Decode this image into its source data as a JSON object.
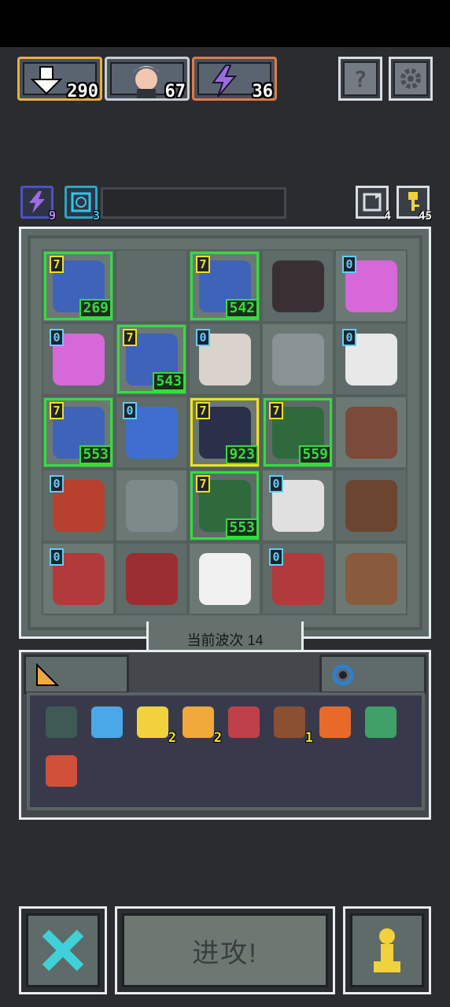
{
  "top_resources": {
    "energy": {
      "value": "290",
      "icon": "down-arrow-icon"
    },
    "hero": {
      "value": "67",
      "icon": "hero-portrait-icon"
    },
    "bolt": {
      "value": "36",
      "icon": "lightning-icon"
    }
  },
  "top_buttons": {
    "help_icon": "question-icon",
    "settings_icon": "gear-icon"
  },
  "buffs": {
    "lightning": {
      "count": "9",
      "icon": "lightning-icon"
    },
    "clock": {
      "count": "3",
      "icon": "clock-icon"
    }
  },
  "side_counters": {
    "refresh": {
      "count": "4",
      "icon": "refresh-icon"
    },
    "key": {
      "count": "45",
      "icon": "key-icon"
    }
  },
  "board": {
    "cells": [
      {
        "unit": "shadow-knight",
        "level": "7",
        "damage": "269",
        "highlight": "green",
        "color": "#3f63b8"
      },
      {
        "unit": "",
        "level": "",
        "damage": "",
        "highlight": "",
        "color": ""
      },
      {
        "unit": "shadow-knight",
        "level": "7",
        "damage": "542",
        "highlight": "green",
        "color": "#3f63b8"
      },
      {
        "unit": "dark-swordsman",
        "level": "",
        "damage": "",
        "highlight": "",
        "color": "#3a3033"
      },
      {
        "unit": "pink-imp",
        "level": "0",
        "damage": "",
        "highlight": "",
        "color": "#d668d9"
      },
      {
        "unit": "pink-imp",
        "level": "0",
        "damage": "",
        "highlight": "",
        "color": "#d668d9"
      },
      {
        "unit": "shadow-knight",
        "level": "7",
        "damage": "543",
        "highlight": "green",
        "color": "#3f63b8"
      },
      {
        "unit": "skeleton-elder",
        "level": "0",
        "damage": "",
        "highlight": "",
        "color": "#d9d3cc"
      },
      {
        "unit": "stone-golem",
        "level": "",
        "damage": "",
        "highlight": "",
        "color": "#8a9296"
      },
      {
        "unit": "white-wizard",
        "level": "0",
        "damage": "",
        "highlight": "",
        "color": "#e8e8e8"
      },
      {
        "unit": "shadow-knight",
        "level": "7",
        "damage": "553",
        "highlight": "green",
        "color": "#3f63b8"
      },
      {
        "unit": "blue-demon",
        "level": "0",
        "damage": "",
        "highlight": "",
        "color": "#3e6fd0"
      },
      {
        "unit": "dark-sorceress",
        "level": "7",
        "damage": "923",
        "highlight": "yellow",
        "color": "#2a2f4a"
      },
      {
        "unit": "green-witch",
        "level": "7",
        "damage": "559",
        "highlight": "green",
        "color": "#2f6a3c"
      },
      {
        "unit": "brown-beast",
        "level": "",
        "damage": "",
        "highlight": "",
        "color": "#7a4a3a"
      },
      {
        "unit": "horned-demon",
        "level": "0",
        "damage": "",
        "highlight": "",
        "color": "#b8402e"
      },
      {
        "unit": "armored-goblin",
        "level": "",
        "damage": "",
        "highlight": "",
        "color": "#7e8a8a"
      },
      {
        "unit": "green-witch",
        "level": "7",
        "damage": "553",
        "highlight": "green",
        "color": "#2f6a3c"
      },
      {
        "unit": "white-haired-sage",
        "level": "0",
        "damage": "",
        "highlight": "",
        "color": "#e0e0e0"
      },
      {
        "unit": "tree-ent",
        "level": "",
        "damage": "",
        "highlight": "",
        "color": "#6b4530"
      },
      {
        "unit": "red-haired-girl",
        "level": "0",
        "damage": "",
        "highlight": "",
        "color": "#b23a3a"
      },
      {
        "unit": "red-demon",
        "level": "",
        "damage": "",
        "highlight": "",
        "color": "#9a2e30"
      },
      {
        "unit": "white-ghost",
        "level": "",
        "damage": "",
        "highlight": "",
        "color": "#f0f0f0"
      },
      {
        "unit": "red-haired-girl",
        "level": "0",
        "damage": "",
        "highlight": "",
        "color": "#b23a3a"
      },
      {
        "unit": "flower-dryad",
        "level": "",
        "damage": "",
        "highlight": "",
        "color": "#8a5a3c"
      }
    ]
  },
  "wave_label": "当前波次 14",
  "inventory": {
    "tabs": [
      {
        "icon": "cheese-icon"
      },
      {
        "icon": "ring-icon"
      }
    ],
    "items": [
      {
        "icon": "cat-mask-icon",
        "count": ""
      },
      {
        "icon": "feather-icon",
        "count": ""
      },
      {
        "icon": "sparkle-icon",
        "count": "2"
      },
      {
        "icon": "chain-icon",
        "count": "2"
      },
      {
        "icon": "flame-leaf-icon",
        "count": ""
      },
      {
        "icon": "totem-icon",
        "count": "1"
      },
      {
        "icon": "fire-scroll-icon",
        "count": ""
      },
      {
        "icon": "jade-ring-icon",
        "count": ""
      },
      {
        "icon": "arrow-icon",
        "count": ""
      }
    ]
  },
  "bottom": {
    "attack_label": "进攻!",
    "sell_icon": "cross-icon",
    "pawn_icon": "pawn-icon"
  },
  "colors": {
    "background": "#2b2c2f",
    "board": "#6c7874",
    "highlight_green": "#2ee03a",
    "highlight_yellow": "#f2e01c",
    "energy_border": "#e8b13c",
    "bolt_border": "#e07a48"
  }
}
